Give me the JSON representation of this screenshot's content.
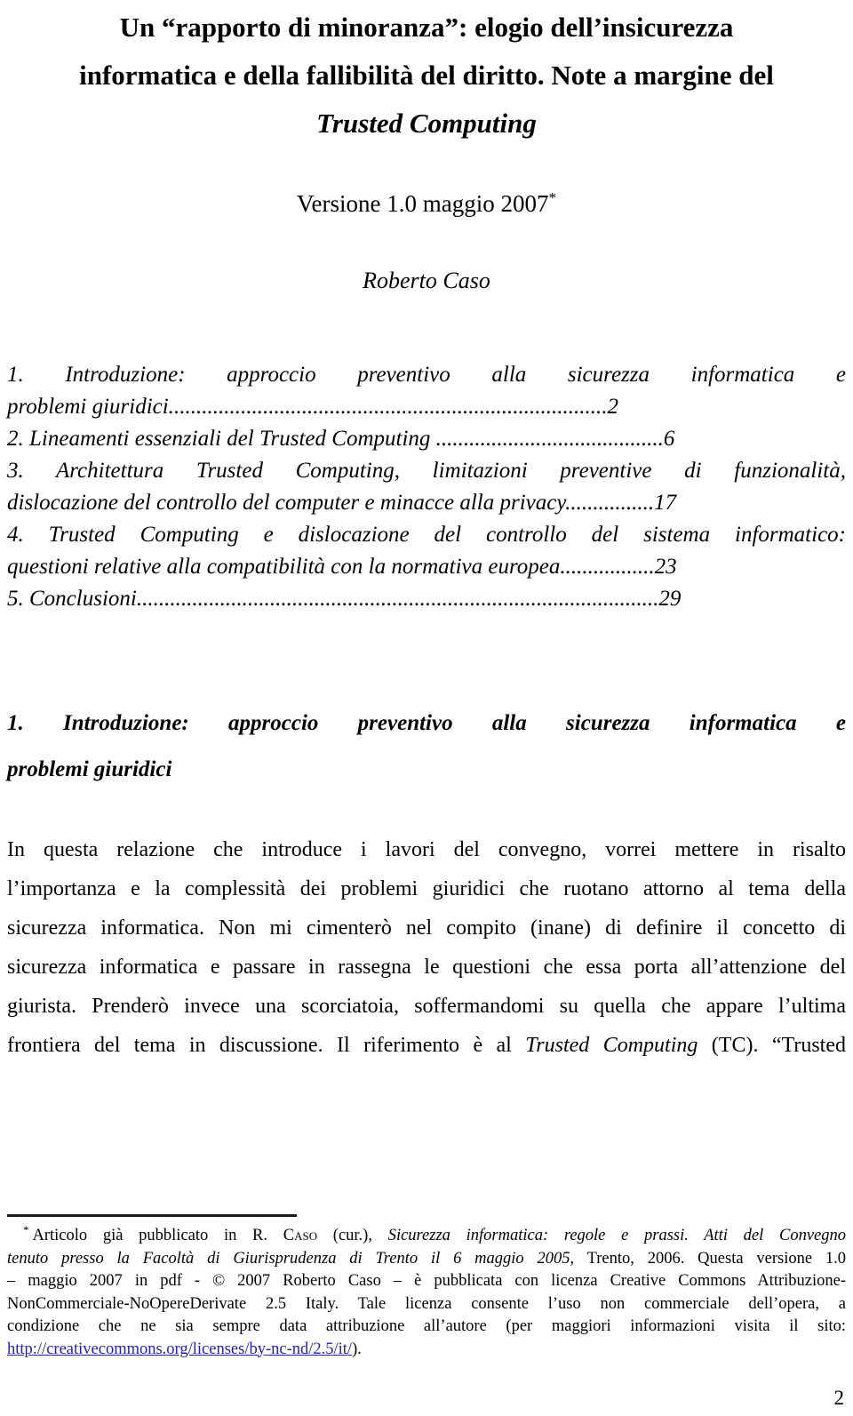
{
  "document": {
    "title_lines": [
      "Un “rapporto di minoranza”: elogio dell’insicurezza",
      "informatica e della fallibilità del diritto. Note a margine del"
    ],
    "title_italic_line": "Trusted Computing",
    "version": "Versione 1.0 maggio 2007",
    "version_footnote_marker": "*",
    "author": "Roberto Caso",
    "page_number": "2"
  },
  "toc": {
    "entries": [
      {
        "line1": "1.  Introduzione: approccio preventivo alla sicurezza informatica e",
        "line2": "problemi giuridici",
        "leader": "...............................................................................",
        "page": "2"
      },
      {
        "line1": "",
        "line2": "2. Lineamenti essenziali  del Trusted Computing",
        "leader": " .........................................",
        "page": "6"
      },
      {
        "line1": "3.  Architettura Trusted Computing, limitazioni preventive di funzionalità,",
        "line2": "dislocazione del controllo del computer e minacce alla privacy",
        "leader": "................",
        "page": "17"
      },
      {
        "line1": "4. Trusted Computing e dislocazione del controllo del sistema informatico:",
        "line2": "questioni relative alla compatibilità con la normativa europea",
        "leader": ".................",
        "page": "23"
      },
      {
        "line1": "",
        "line2": "5. Conclusioni",
        "leader": "..............................................................................................",
        "page": "29"
      }
    ]
  },
  "section": {
    "heading_line1": "1.  Introduzione: approccio preventivo alla sicurezza informatica e",
    "heading_line2": "problemi giuridici"
  },
  "body": {
    "lines": [
      "In questa relazione che introduce i lavori del convegno, vorrei mettere in risalto",
      "l’importanza e la complessità dei problemi giuridici che ruotano attorno al tema della",
      "sicurezza informatica. Non mi cimenterò nel compito (inane) di definire il concetto di",
      "sicurezza informatica e passare in rassegna le questioni che essa porta all’attenzione del",
      "giurista. Prenderò invece una scorciatoia, soffermandomi su quella che appare l’ultima"
    ],
    "last_line_pre": "frontiera del tema in discussione. Il riferimento è al ",
    "last_line_italic": "Trusted Computing",
    "last_line_post": " (TC). “Trusted"
  },
  "footnote": {
    "marker": "*",
    "line1_a": "Articolo già pubblicato in R. ",
    "line1_smallcaps": "Caso",
    "line1_b": " (cur.), ",
    "line1_italic": "Sicurezza informatica: regole e prassi. Atti del Convegno",
    "line2_italic": "tenuto presso la Facoltà di Giurisprudenza di Trento il 6 maggio 2005",
    "line2_rest": ", Trento, 2006. Questa versione 1.0",
    "line3": "– maggio 2007 in pdf - © 2007 Roberto Caso – è pubblicata con licenza Creative Commons Attribuzione-",
    "line4": "NonCommerciale-NoOpereDerivate 2.5 Italy. Tale licenza consente l’uso non commerciale dell’opera, a",
    "line5": "condizione che ne sia sempre data attribuzione all’autore (per maggiori informazioni visita il sito:",
    "link_text": "http://creativecommons.org/licenses/by-nc-nd/2.5/it/",
    "line6_tail": ")."
  },
  "colors": {
    "text": "#000000",
    "link": "#2222aa",
    "rule": "#1a1a1a",
    "background": "#ffffff"
  }
}
